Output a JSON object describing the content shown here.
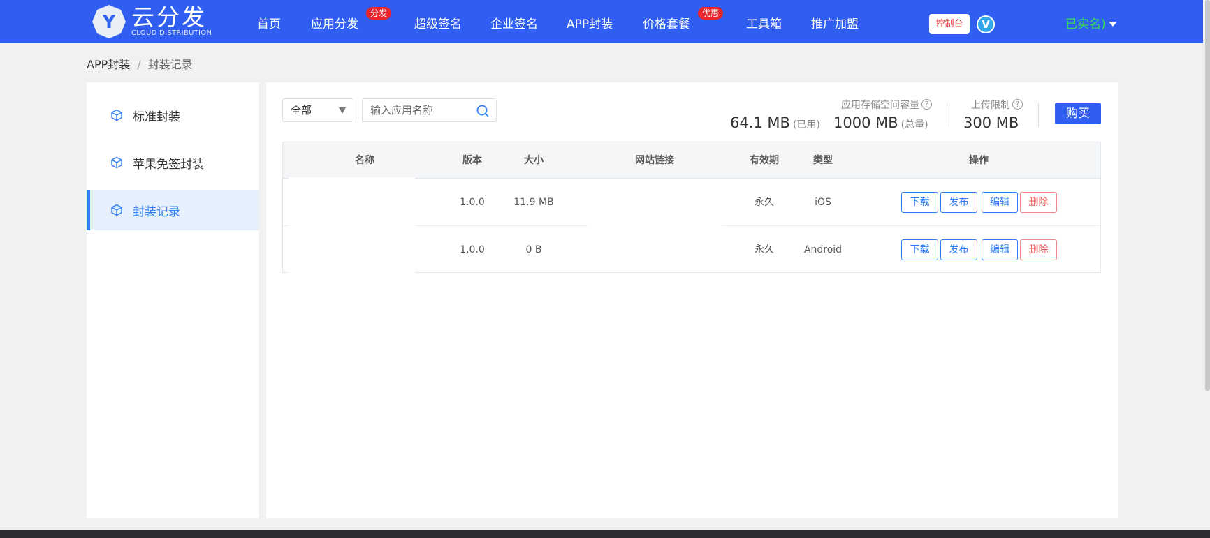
{
  "brand": {
    "name": "云分发",
    "tagline": "CLOUD DISTRIBUTION",
    "logo_letter": "Y"
  },
  "nav": {
    "items": [
      {
        "label": "首页"
      },
      {
        "label": "应用分发",
        "badge": "分发"
      },
      {
        "label": "超级签名"
      },
      {
        "label": "企业签名"
      },
      {
        "label": "APP封装"
      },
      {
        "label": "价格套餐",
        "badge": "优惠"
      },
      {
        "label": "工具箱"
      },
      {
        "label": "推广加盟"
      }
    ],
    "console_label": "控制台",
    "vip_letter": "V",
    "user_status": "已实名)"
  },
  "breadcrumb": {
    "root": "APP封装",
    "separator": "/",
    "current": "封装记录"
  },
  "sidebar": {
    "items": [
      {
        "label": "标准封装"
      },
      {
        "label": "苹果免签封装"
      },
      {
        "label": "封装记录",
        "active": true
      }
    ]
  },
  "filters": {
    "select_value": "全部",
    "search_placeholder": "输入应用名称"
  },
  "storage": {
    "capacity_label": "应用存储空间容量",
    "used_value": "64.1 MB",
    "used_unit": "(已用)",
    "total_value": "1000 MB",
    "total_unit": "(总量)",
    "upload_label": "上传限制",
    "upload_value": "300 MB",
    "help_symbol": "?"
  },
  "buy_label": "购买",
  "table": {
    "headers": {
      "name": "名称",
      "version": "版本",
      "size": "大小",
      "link": "网站链接",
      "validity": "有效期",
      "type": "类型",
      "ops": "操作"
    },
    "rows": [
      {
        "version": "1.0.0",
        "size": "11.9 MB",
        "validity": "永久",
        "type": "iOS"
      },
      {
        "version": "1.0.0",
        "size": "0 B",
        "validity": "永久",
        "type": "Android"
      }
    ],
    "actions": {
      "download": "下载",
      "publish": "发布",
      "edit": "编辑",
      "delete": "删除"
    }
  },
  "colors": {
    "header_bg": "#2f5ef0",
    "accent": "#2f7ef5",
    "badge_red": "#e8252b",
    "realname_green": "#35df5a",
    "danger": "#ee5757"
  }
}
